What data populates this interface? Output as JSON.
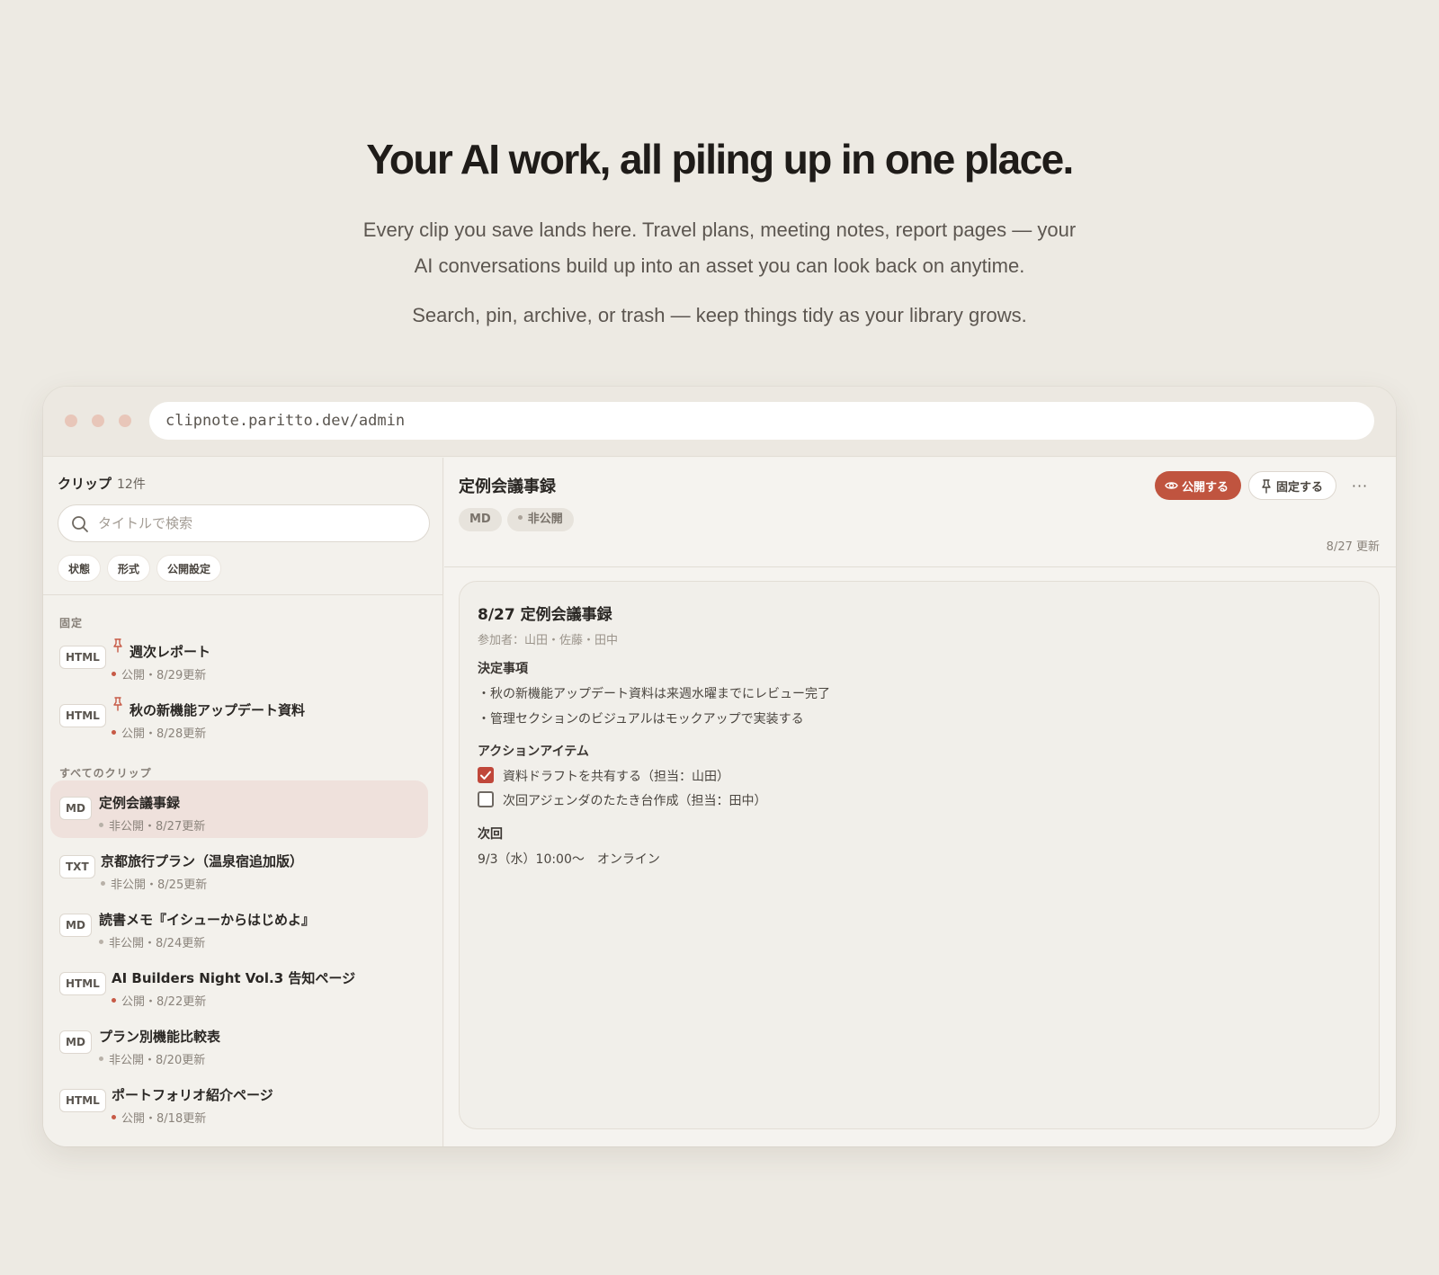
{
  "hero": {
    "title": "Your AI work, all piling up in one place.",
    "sub1_line1": "Every clip you save lands here. Travel plans, meeting notes, report pages — your",
    "sub1_line2": "AI conversations build up into an asset you can look back on anytime.",
    "sub2": "Search, pin, archive, or trash — keep things tidy as your library grows."
  },
  "browser": {
    "url": "clipnote.paritto.dev/admin"
  },
  "sidebar": {
    "title": "クリップ",
    "count": "12件",
    "search_placeholder": "タイトルで検索",
    "filters": [
      "状態",
      "形式",
      "公開設定"
    ],
    "pinned_label": "固定",
    "all_label": "すべてのクリップ",
    "pinned": [
      {
        "format": "HTML",
        "title": "週次レポート",
        "status": "公開",
        "date": "8/29更新"
      },
      {
        "format": "HTML",
        "title": "秋の新機能アップデート資料",
        "status": "公開",
        "date": "8/28更新"
      }
    ],
    "items": [
      {
        "format": "MD",
        "title": "定例会議事録",
        "status": "非公開",
        "date": "8/27更新"
      },
      {
        "format": "TXT",
        "title": "京都旅行プラン（温泉宿追加版）",
        "status": "非公開",
        "date": "8/25更新"
      },
      {
        "format": "MD",
        "title": "読書メモ『イシューからはじめよ』",
        "status": "非公開",
        "date": "8/24更新"
      },
      {
        "format": "HTML",
        "title": "AI Builders Night Vol.3 告知ページ",
        "status": "公開",
        "date": "8/22更新"
      },
      {
        "format": "MD",
        "title": "プラン別機能比較表",
        "status": "非公開",
        "date": "8/20更新"
      },
      {
        "format": "HTML",
        "title": "ポートフォリオ紹介ページ",
        "status": "公開",
        "date": "8/18更新"
      }
    ]
  },
  "main": {
    "title": "定例会議事録",
    "format_tag": "MD",
    "visibility_tag": "非公開",
    "publish_label": "公開する",
    "pin_label": "固定する",
    "more_label": "···",
    "updated": "8/27 更新",
    "doc": {
      "title": "8/27 定例会議事録",
      "attendees": "参加者：山田・佐藤・田中",
      "decisions_heading": "決定事項",
      "decisions": [
        "・秋の新機能アップデート資料は来週水曜までにレビュー完了",
        "・管理セクションのビジュアルはモックアップで実装する"
      ],
      "actions_heading": "アクションアイテム",
      "actions": [
        {
          "label": "資料ドラフトを共有する（担当：山田）",
          "done": true
        },
        {
          "label": "次回アジェンダのたたき台作成（担当：田中）",
          "done": false
        }
      ],
      "next_heading": "次回",
      "next": "9/3（水）10:00〜　オンライン"
    }
  },
  "colors": {
    "accent": "#c0543f",
    "background": "#edeae3",
    "active_item": "#efe1dc"
  }
}
